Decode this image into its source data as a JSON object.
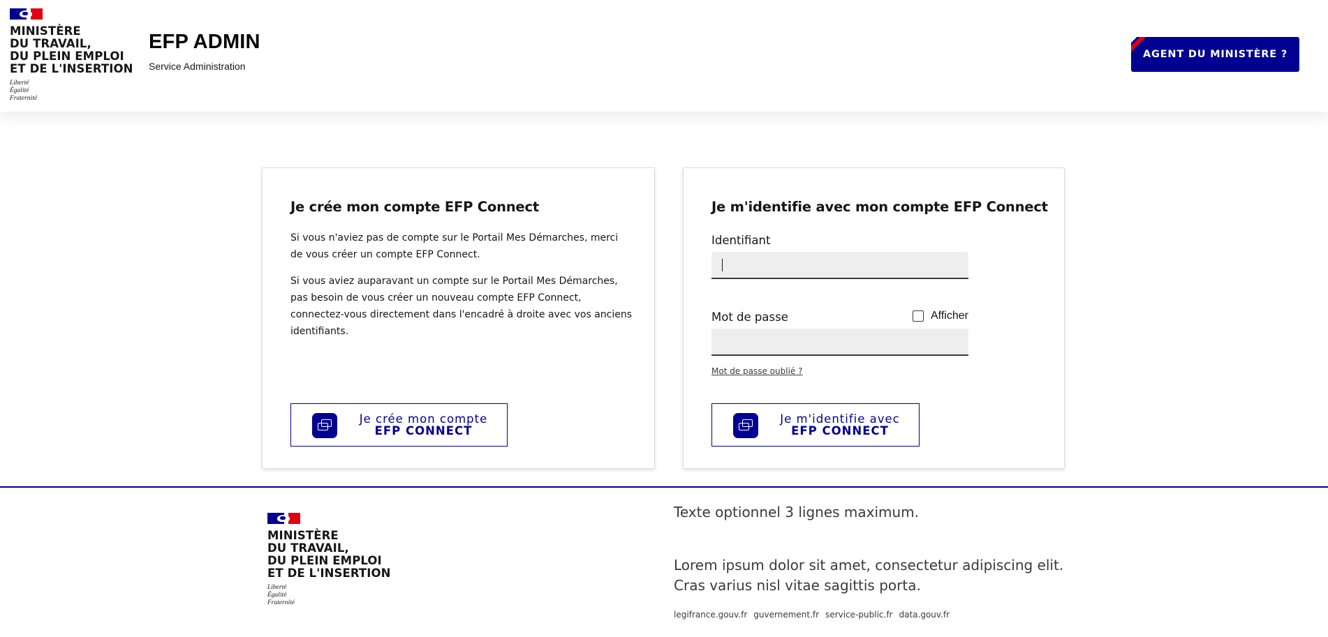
{
  "header": {
    "ministry_lines": [
      "Ministère",
      "du travail,",
      "du plein emploi",
      "et de l'insertion"
    ],
    "motto_lines": [
      "Liberté",
      "Égalité",
      "Fraternité"
    ],
    "service_title": "EFP ADMIN",
    "service_tagline": "Service Administration",
    "agent_button": "AGENT DU MINISTÈRE ?"
  },
  "create_card": {
    "title": "Je crée mon compte EFP Connect",
    "paragraph1": "Si vous n'aviez pas de compte sur le Portail Mes Démarches, merci de vous créer un compte EFP Connect.",
    "paragraph2": "Si vous aviez auparavant un compte sur le Portail Mes Démarches, pas besoin de vous créer un nouveau compte EFP Connect, connectez-vous directement dans l'encadré à droite avec vos anciens identifiants.",
    "button_line1": "Je crée mon compte",
    "button_line2": "EFP CONNECT"
  },
  "login_card": {
    "title": "Je m'identifie avec mon compte EFP Connect",
    "identifier_label": "Identifiant",
    "identifier_value": "",
    "password_label": "Mot de passe",
    "password_value": "",
    "show_password_label": "Afficher",
    "forgot_link": "Mot de passe oublié ?",
    "button_line1": "Je m'identifie avec",
    "button_line2": "EFP CONNECT"
  },
  "footer": {
    "ministry_lines": [
      "Ministère",
      "du travail,",
      "du plein emploi",
      "et de l'insertion"
    ],
    "motto_lines": [
      "Liberté",
      "Égalité",
      "Fraternité"
    ],
    "optional_text": "Texte optionnel 3 lignes maximum.",
    "description": "Lorem ipsum dolor sit amet, consectetur adipiscing elit. Cras varius nisl vitae sagittis porta.",
    "links": [
      "legifrance.gouv.fr",
      "guvernement.fr",
      "service-public.fr",
      "data.gouv.fr"
    ]
  },
  "colors": {
    "primary_blue": "#000091",
    "marianne_red": "#e1000f",
    "input_background": "#eeeeee"
  }
}
